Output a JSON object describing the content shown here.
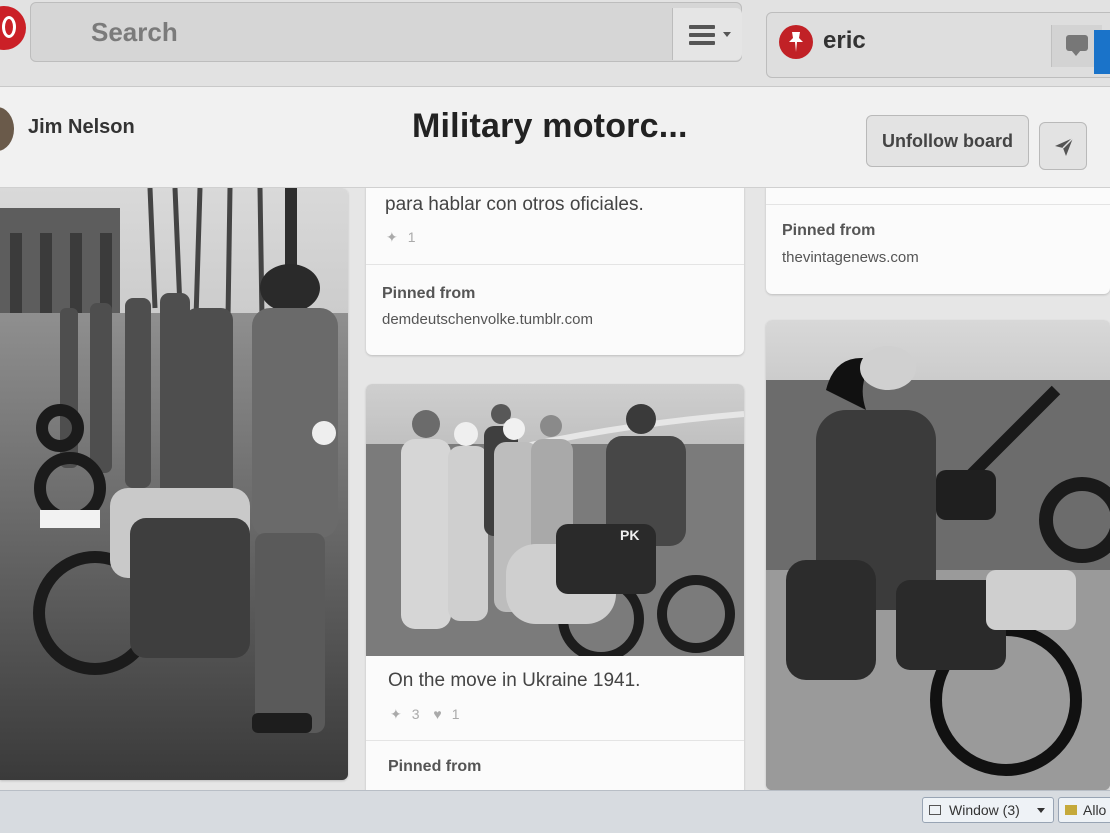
{
  "topbar": {
    "search_placeholder": "Search",
    "user_name": "eric"
  },
  "board": {
    "owner_name": "Jim Nelson",
    "title": "Military motorc...",
    "unfollow_label": "Unfollow board"
  },
  "pins": {
    "col2_top": {
      "description": "para hablar con otros oficiales.",
      "repins": "1",
      "pinned_from_label": "Pinned from",
      "source": "demdeutschenvolke.tumblr.com"
    },
    "col3_top": {
      "pinned_from_label": "Pinned from",
      "source": "thevintagenews.com"
    },
    "col2_second": {
      "description": "On the move in Ukraine 1941.",
      "repins": "3",
      "likes": "1",
      "pinned_from_label": "Pinned from"
    }
  },
  "taskbar": {
    "window_label": "Window (3)",
    "allow_label": "Allo"
  },
  "colors": {
    "brand_red": "#cb2027",
    "accent_blue": "#1a73c9"
  }
}
